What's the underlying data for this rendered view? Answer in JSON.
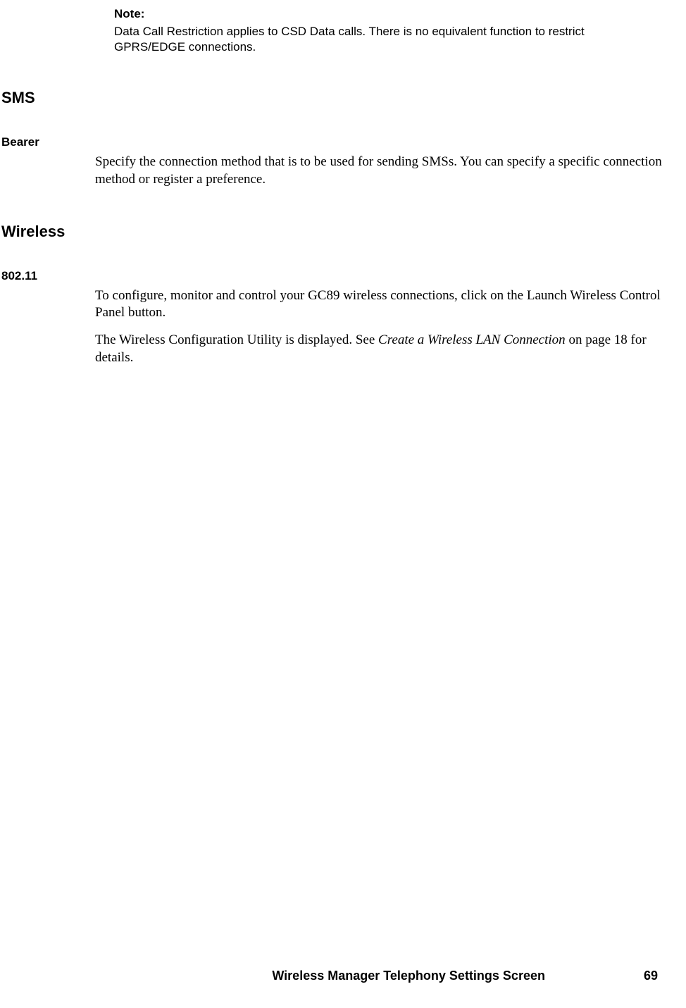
{
  "note": {
    "label": "Note:",
    "text": "Data Call Restriction applies to CSD Data calls. There is no equivalent function to restrict GPRS/EDGE connections."
  },
  "sections": {
    "sms": {
      "heading": "SMS",
      "bearer": {
        "label": "Bearer",
        "text": "Specify the connection method that is to be used for sending SMSs. You can specify a specific connection method or register a preference."
      }
    },
    "wireless": {
      "heading": "Wireless",
      "w80211": {
        "label": "802.11",
        "para1": "To configure, monitor and control your GC89 wireless connections, click on the Launch Wireless Control Panel button.",
        "para2_pre": "The Wireless Configuration Utility is displayed. See ",
        "para2_italic": "Create a Wireless LAN Connection",
        "para2_post": " on page 18 for details."
      }
    }
  },
  "footer": {
    "title": "Wireless Manager Telephony Settings Screen",
    "page_number": "69"
  }
}
